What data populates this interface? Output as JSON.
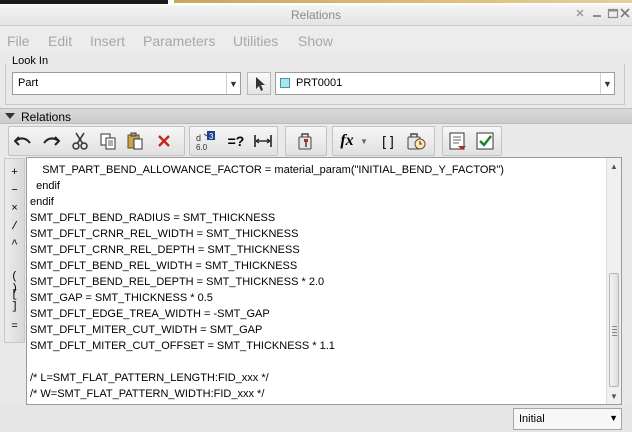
{
  "window": {
    "title": "Relations"
  },
  "menu": [
    "File",
    "Edit",
    "Insert",
    "Parameters",
    "Utilities",
    "Show"
  ],
  "look_in": {
    "label": "Look In",
    "type_value": "Part",
    "model_value": "PRT0001"
  },
  "relations": {
    "section_label": "Relations"
  },
  "toolbar_icons": [
    "undo-icon",
    "redo-icon",
    "cut-icon",
    "copy-icon",
    "paste-icon",
    "delete-icon",
    "evaluate-selection-icon",
    "verify-relations-icon",
    "dimension-icon",
    "sort-relations-icon",
    "function-icon",
    "parameters-icon",
    "units-icon",
    "show-dimensions-icon",
    "verify-icon"
  ],
  "toolbar_text": {
    "units": "=?",
    "fx": "fx",
    "brackets": "[ ]"
  },
  "operators": [
    "+",
    "−",
    "×",
    "/",
    "^",
    "( )",
    "[ ]",
    "="
  ],
  "editor_lines": [
    "    SMT_PART_BEND_ALLOWANCE_FACTOR = material_param(\"INITIAL_BEND_Y_FACTOR\")",
    "  endif",
    "endif",
    "SMT_DFLT_BEND_RADIUS = SMT_THICKNESS",
    "SMT_DFLT_CRNR_REL_WIDTH = SMT_THICKNESS",
    "SMT_DFLT_CRNR_REL_DEPTH = SMT_THICKNESS",
    "SMT_DFLT_BEND_REL_WIDTH = SMT_THICKNESS",
    "SMT_DFLT_BEND_REL_DEPTH = SMT_THICKNESS * 2.0",
    "SMT_GAP = SMT_THICKNESS * 0.5",
    "SMT_DFLT_EDGE_TREA_WIDTH = -SMT_GAP",
    "SMT_DFLT_MITER_CUT_WIDTH = SMT_GAP",
    "SMT_DFLT_MITER_CUT_OFFSET = SMT_THICKNESS * 1.1",
    "",
    "/* L=SMT_FLAT_PATTERN_LENGTH:FID_xxx */",
    "/* W=SMT_FLAT_PATTERN_WIDTH:FID_xxx */"
  ],
  "bottom_select": {
    "value": "Initial"
  }
}
